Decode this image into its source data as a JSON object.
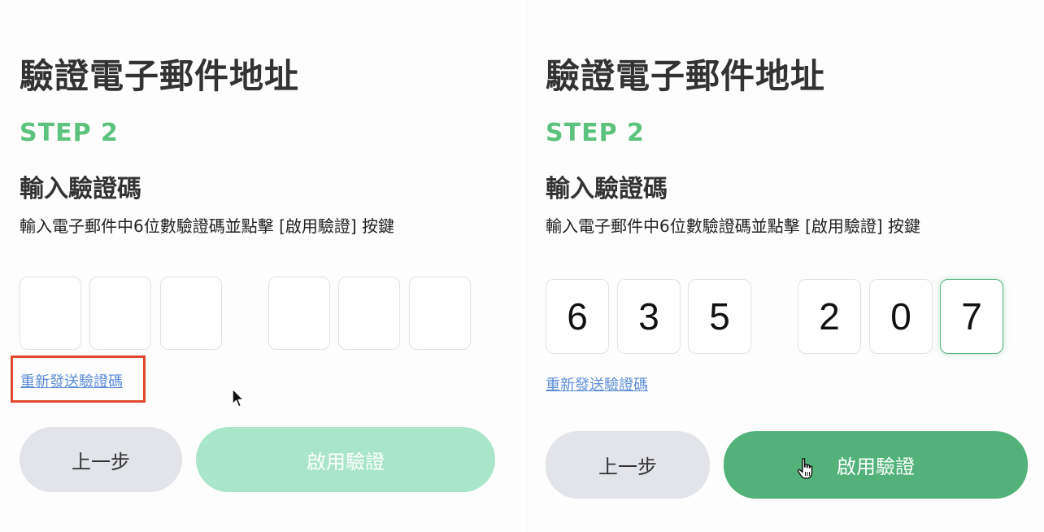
{
  "left_panel": {
    "title": "驗證電子郵件地址",
    "step": "STEP 2",
    "subtitle": "輸入驗證碼",
    "description": "輸入電子郵件中6位數驗證碼並點擊 [啟用驗證] 按鍵",
    "code_digits": [
      "",
      "",
      "",
      "",
      "",
      ""
    ],
    "resend_link": "重新發送驗證碼",
    "back_button": "上一步",
    "enable_button": "啟用驗證",
    "enable_button_state": "disabled"
  },
  "right_panel": {
    "title": "驗證電子郵件地址",
    "step": "STEP 2",
    "subtitle": "輸入驗證碼",
    "description": "輸入電子郵件中6位數驗證碼並點擊 [啟用驗證] 按鍵",
    "code_digits": [
      "6",
      "3",
      "5",
      "2",
      "0",
      "7"
    ],
    "resend_link": "重新發送驗證碼",
    "back_button": "上一步",
    "enable_button": "啟用驗證",
    "enable_button_state": "enabled"
  },
  "colors": {
    "step_green": "#5cc27e",
    "primary_button": "#52b27a",
    "primary_button_disabled": "#a9e6c9",
    "back_button": "#e2e4e9",
    "link_blue": "#5b8ed6",
    "highlight_red": "#e0492f"
  },
  "icons": {
    "left_cursor": "arrow-cursor-icon",
    "right_cursor": "hand-pointer-icon"
  }
}
